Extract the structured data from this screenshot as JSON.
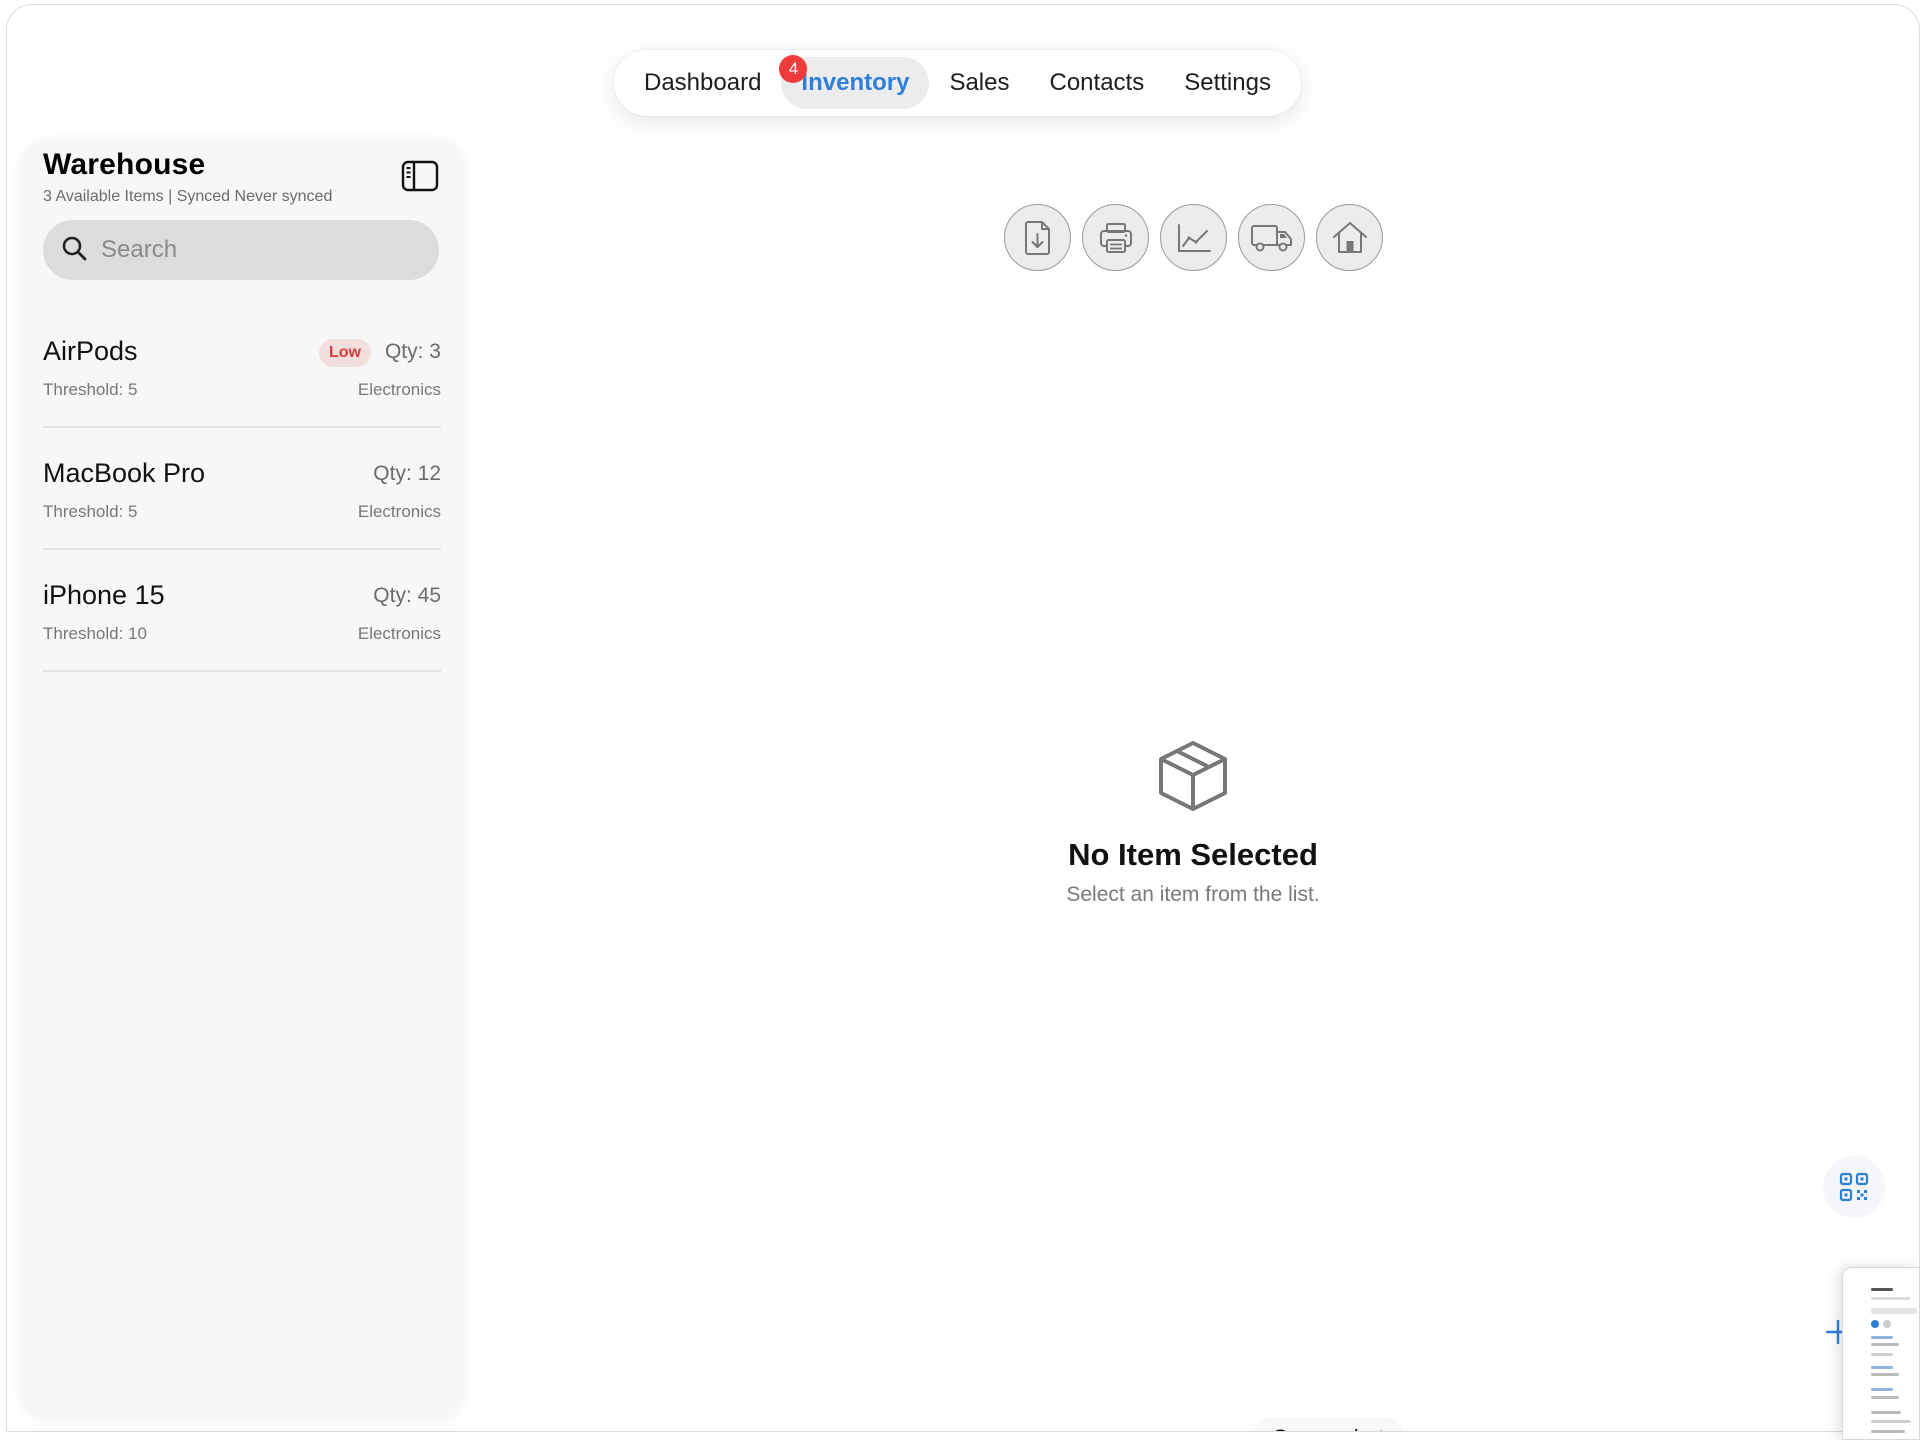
{
  "tabs": [
    {
      "label": "Dashboard",
      "badge": "4"
    },
    {
      "label": "Inventory",
      "active": true
    },
    {
      "label": "Sales"
    },
    {
      "label": "Contacts"
    },
    {
      "label": "Settings"
    }
  ],
  "sidebar": {
    "title": "Warehouse",
    "subtitle": "3 Available Items | Synced Never synced",
    "search_placeholder": "Search",
    "items": [
      {
        "name": "AirPods",
        "threshold": "Threshold: 5",
        "qty": "Qty: 3",
        "category": "Electronics",
        "badge": "Low"
      },
      {
        "name": "MacBook Pro",
        "threshold": "Threshold: 5",
        "qty": "Qty: 12",
        "category": "Electronics"
      },
      {
        "name": "iPhone 15",
        "threshold": "Threshold: 10",
        "qty": "Qty: 45",
        "category": "Electronics"
      }
    ]
  },
  "toolbar": {
    "icons": [
      "document-download-icon",
      "printer-icon",
      "chart-line-icon",
      "truck-icon",
      "home-icon"
    ]
  },
  "empty_state": {
    "icon": "box-icon",
    "title": "No Item Selected",
    "subtitle": "Select an item from the list."
  },
  "floating": {
    "qr_icon": "qr-code-icon",
    "add_icon": "plus-icon",
    "screenshot_label": "Screenshot"
  },
  "colors": {
    "accent": "#2d7fd8",
    "badge_red": "#ef3b3b",
    "low_text": "#d83b3b",
    "low_bg": "#f3dede"
  }
}
